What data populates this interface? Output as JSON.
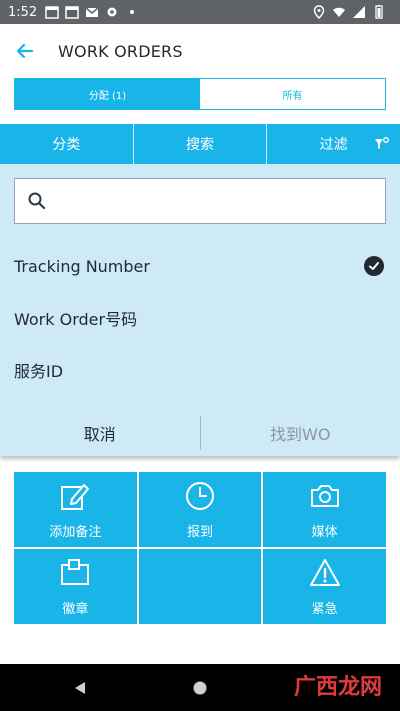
{
  "status_bar": {
    "time": "1:52"
  },
  "header": {
    "title": "WORK ORDERS"
  },
  "segments": [
    {
      "label": "分配 (1)",
      "active": true
    },
    {
      "label": "所有",
      "active": false
    }
  ],
  "toolbar": {
    "sort": "分类",
    "search": "搜索",
    "filter": "过滤"
  },
  "search_panel": {
    "placeholder": "",
    "options": [
      {
        "label": "Tracking Number",
        "selected": true
      },
      {
        "label": "Work Order号码",
        "selected": false
      },
      {
        "label": "服务ID",
        "selected": false
      }
    ],
    "cancel_label": "取消",
    "find_label": "找到WO"
  },
  "grid": {
    "add_note": "添加备注",
    "check_in": "报到",
    "media": "媒体",
    "badge": "徽章",
    "empty": "",
    "urgent": "紧急"
  },
  "watermark": "广西龙网",
  "colors": {
    "accent": "#1ab5e8",
    "panel": "#cfeaf7",
    "text": "#1f2a33"
  }
}
